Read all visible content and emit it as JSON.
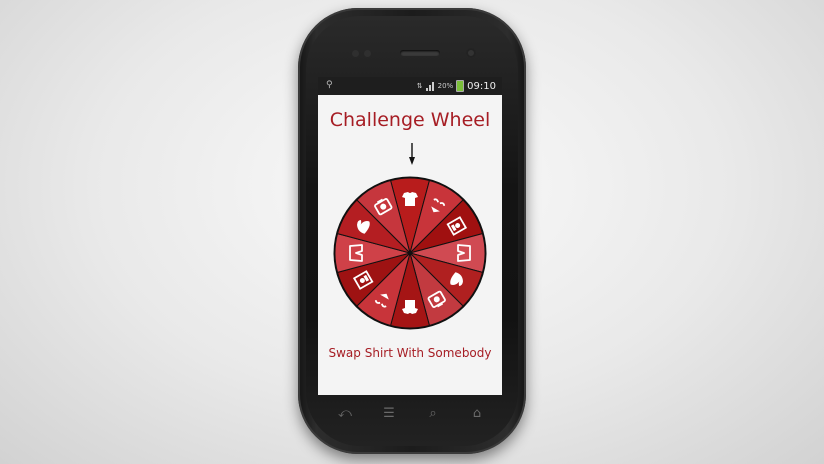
{
  "status_bar": {
    "battery": "20%",
    "time": "09:10"
  },
  "app": {
    "title": "Challenge Wheel",
    "result": "Swap Shirt With Somebody"
  },
  "wheel": {
    "segments": [
      {
        "icon": "shirt-icon",
        "color": "#b81c1c"
      },
      {
        "icon": "bikini-icon",
        "color": "#c8343a"
      },
      {
        "icon": "photo-frame-icon",
        "color": "#a01010"
      },
      {
        "icon": "shorts-icon",
        "color": "#d04a52"
      },
      {
        "icon": "bicep-icon",
        "color": "#b02020"
      },
      {
        "icon": "camera-icon",
        "color": "#c23a40"
      },
      {
        "icon": "shirt-icon",
        "color": "#a51515"
      },
      {
        "icon": "bikini-icon",
        "color": "#c8343a"
      },
      {
        "icon": "photo-frame-icon",
        "color": "#9e1212"
      },
      {
        "icon": "shorts-icon",
        "color": "#cf4148"
      },
      {
        "icon": "bicep-icon",
        "color": "#b41e22"
      },
      {
        "icon": "camera-icon",
        "color": "#c6363d"
      }
    ]
  },
  "nav": {
    "back": "back-icon",
    "menu": "menu-icon",
    "search": "search-icon",
    "home": "home-icon"
  }
}
